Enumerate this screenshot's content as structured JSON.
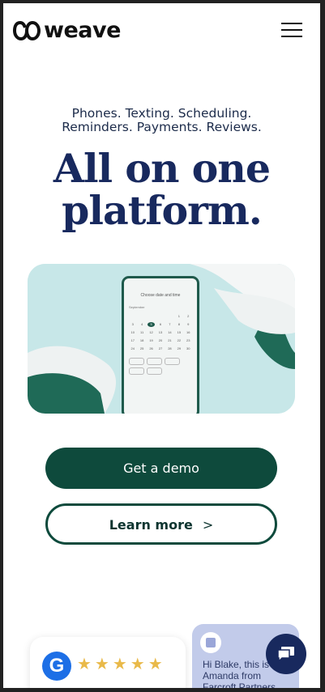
{
  "header": {
    "brand": "weave",
    "menu_icon": "hamburger-menu-icon"
  },
  "hero": {
    "tagline": "Phones. Texting. Scheduling. Reminders. Payments. Reviews.",
    "headline": "All on one platform."
  },
  "actions": {
    "primary_label": "Get a demo",
    "secondary_label": "Learn more",
    "secondary_chevron": ">"
  },
  "review_card": {
    "badge_letter": "G",
    "stars": "★★★★★"
  },
  "message_card": {
    "text": "Hi Blake, this is Amanda from Farcroft Partners"
  },
  "colors": {
    "brand_green": "#0e4a3c",
    "headline_navy": "#18295e",
    "star_gold": "#e9b949",
    "google_blue": "#1d6fe6"
  }
}
